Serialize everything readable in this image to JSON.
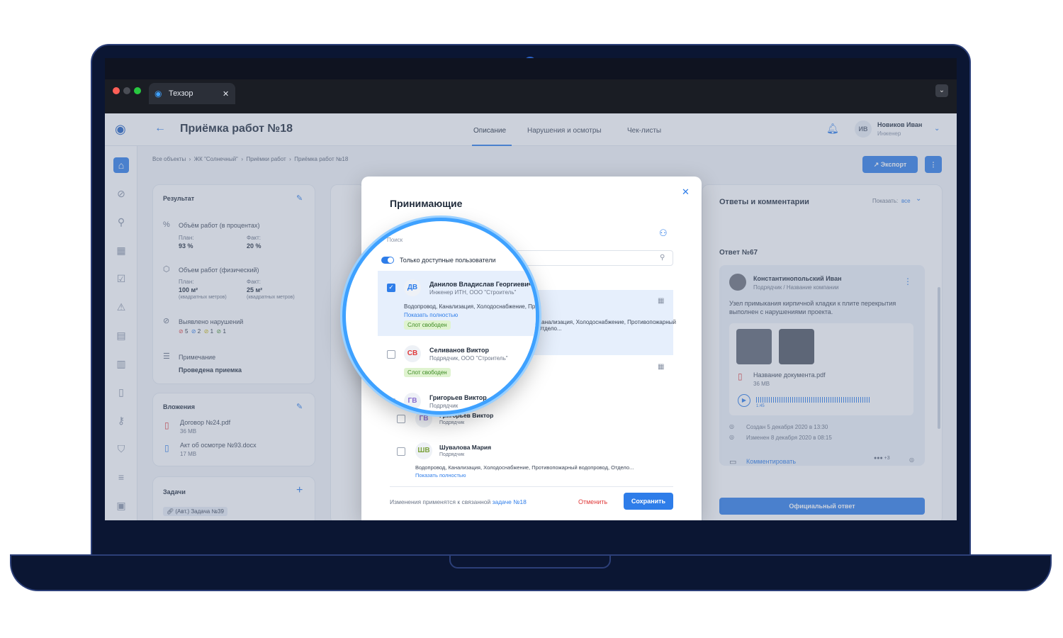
{
  "browser": {
    "tab_title": "Техзор",
    "close": "✕"
  },
  "header": {
    "title": "Приёмка работ №18",
    "tabs": [
      "Описание",
      "Нарушения и осмотры",
      "Чек-листы"
    ],
    "user_initials": "ИВ",
    "user_name": "Новиков Иван",
    "user_role": "Инженер"
  },
  "breadcrumbs": [
    "Все объекты",
    "ЖК \"Солнечный\"",
    "Приёмки работ",
    "Приёмка работ №18"
  ],
  "toolbar": {
    "export": "Экспорт"
  },
  "result": {
    "title": "Результат",
    "percent": {
      "label": "Объём работ (в процентах)",
      "plan_label": "План:",
      "plan": "93 %",
      "fact_label": "Факт:",
      "fact": "20 %"
    },
    "physical": {
      "label": "Объем работ (физический)",
      "plan_label": "План:",
      "plan": "100 м²",
      "plan_unit": "(квадратных метров)",
      "fact_label": "Факт:",
      "fact": "25 м²",
      "fact_unit": "(квадратных метров)"
    },
    "violations": {
      "label": "Выявлено нарушений",
      "counts": [
        "5",
        "2",
        "1",
        "1"
      ]
    },
    "note": {
      "label": "Примечание",
      "value": "Проведена приемка"
    }
  },
  "attachments": {
    "title": "Вложения",
    "files": [
      {
        "name": "Договор №24.pdf",
        "size": "36 МВ"
      },
      {
        "name": "Акт об осмотре №93.docx",
        "size": "17 МВ"
      }
    ]
  },
  "tasks": {
    "title": "Задачи",
    "item": "(Авт.) Задача №39"
  },
  "comments": {
    "title": "Ответы и комментарии",
    "show_label": "Показать:",
    "show_value": "все",
    "answer_title": "Ответ №67",
    "author": "Константинопольский Иван",
    "author_role": "Подрядчик / Название компании",
    "text": "Узел примыкания кирпичной кладки к плите перекрытия выполнен с нарушениями проекта.",
    "doc_name": "Название документа.pdf",
    "doc_size": "36 МВ",
    "audio_time": "1:45",
    "created": "Создан 5 декабря 2020 в 13:30",
    "changed": "Изменен 8 декабря 2020 в 08:15",
    "comment_btn": "Комментировать",
    "official": "Официальный ответ",
    "more_count": "+3"
  },
  "modal": {
    "title": "Принимающие",
    "search_placeholder": "Поиск",
    "toggle_label": "Только доступные пользователи",
    "people": [
      {
        "initials": "ДВ",
        "name": "Данилов Владислав Георгиевич",
        "role": "Инженер ИТН, ООО \"Строитель\"",
        "details": "Водопровод, Канализация, Холодоснабжение, Противопожарный водопровод, Отдело...",
        "show_more": "Показать полностью",
        "slot": "Слот свободен"
      },
      {
        "initials": "СВ",
        "name": "Селиванов Виктор",
        "role": "Подрядчик, ООО \"Строитель\"",
        "slot": "Слот свободен"
      },
      {
        "initials": "ГВ",
        "name": "Григорьев Виктор",
        "role": "Подрядчик"
      },
      {
        "initials": "ШВ",
        "name": "Шувалова Мария",
        "role": "Подрядчик",
        "details": "Водопровод, Канализация, Холодоснабжение, Противопожарный водопровод, Отдело...",
        "show_more": "Показать полностью"
      }
    ],
    "footer_note": "Изменения применятся к связанной",
    "footer_link": "задаче №18",
    "cancel": "Отменить",
    "save": "Сохранить"
  },
  "colors": {
    "accent": "#2e7de9",
    "danger": "#e03a3a",
    "success": "#3c8a22"
  }
}
